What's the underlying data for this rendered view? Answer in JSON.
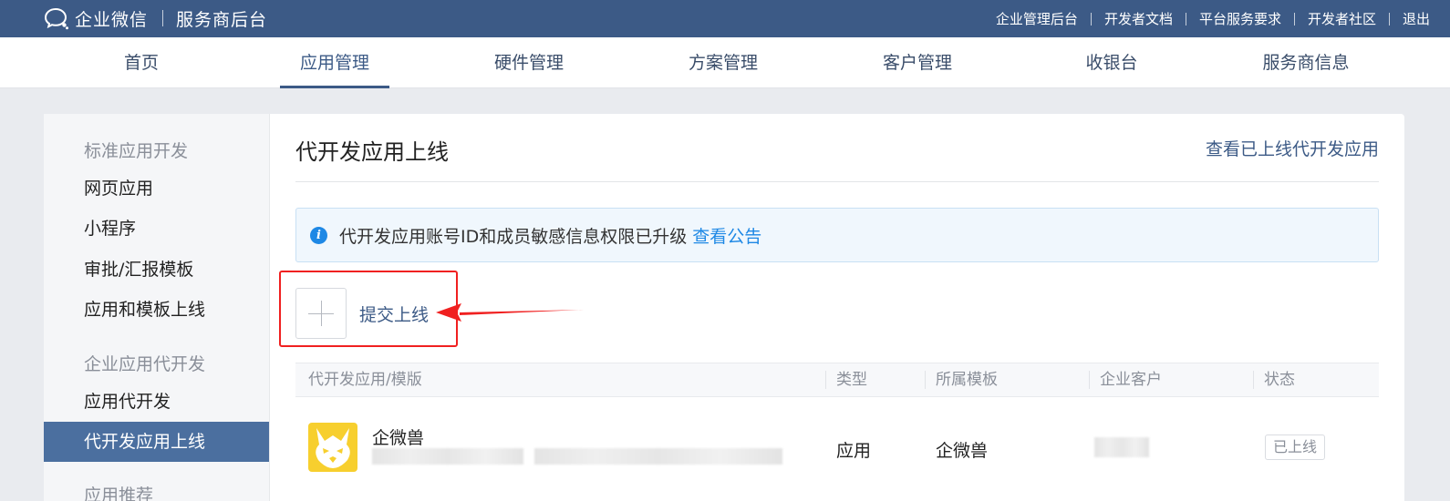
{
  "header": {
    "brand_name": "企业微信",
    "brand_sub": "服务商后台",
    "links": [
      "企业管理后台",
      "开发者文档",
      "平台服务要求",
      "开发者社区",
      "退出"
    ]
  },
  "nav": {
    "items": [
      "首页",
      "应用管理",
      "硬件管理",
      "方案管理",
      "客户管理",
      "收银台",
      "服务商信息"
    ],
    "active": "应用管理"
  },
  "sidebar": {
    "group1": "标准应用开发",
    "group1_items": [
      "网页应用",
      "小程序",
      "审批/汇报模板",
      "应用和模板上线"
    ],
    "group2": "企业应用代开发",
    "group2_items": [
      "应用代开发",
      "代开发应用上线"
    ],
    "group3": "应用推荐",
    "active": "代开发应用上线"
  },
  "main": {
    "title": "代开发应用上线",
    "view_link": "查看已上线代开发应用",
    "notice_text": "代开发应用账号ID和成员敏感信息权限已升级",
    "notice_link": "查看公告",
    "submit_label": "提交上线"
  },
  "table": {
    "headers": [
      "代开发应用/模版",
      "类型",
      "所属模板",
      "企业客户",
      "状态"
    ],
    "rows": [
      {
        "name": "企微兽",
        "type": "应用",
        "template": "企微兽",
        "status": "已上线"
      }
    ]
  },
  "icons": {
    "brand": "wecom-logo-icon",
    "notice": "info-icon",
    "submit": "plus-icon",
    "app": "qiweishou-app-icon",
    "annotation": "red-arrow-icon"
  },
  "colors": {
    "header_bg": "#3c5a86",
    "accent": "#3c5a86",
    "sidebar_active_bg": "#4b6f9f",
    "info_blue": "#1e88e5",
    "annotation_red": "#f02020",
    "app_icon_bg": "#f7cf2e"
  }
}
